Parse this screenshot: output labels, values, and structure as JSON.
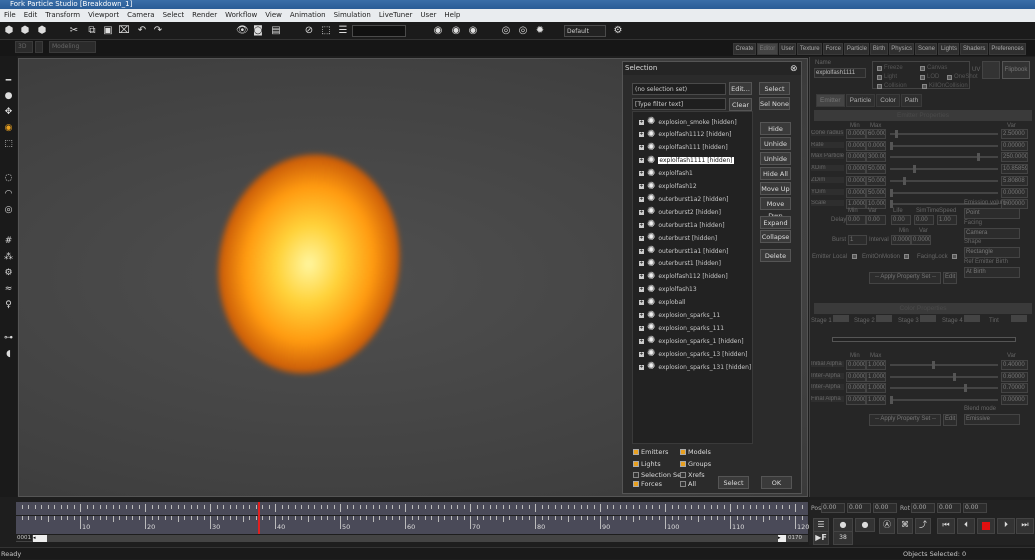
{
  "window": {
    "title": "Fork Particle Studio [Breakdown_1]"
  },
  "menu": [
    "File",
    "Edit",
    "Transform",
    "Viewport",
    "Camera",
    "Select",
    "Render",
    "Workflow",
    "View",
    "Animation",
    "Simulation",
    "LiveTuner",
    "User",
    "Help"
  ],
  "toolbar": {
    "preset_value": "Default",
    "view_mode": "3D",
    "mode_value": "Modeling"
  },
  "right_tabs": [
    "Create",
    "Editor",
    "User",
    "Texture",
    "Force",
    "Particle",
    "Birth",
    "Physics",
    "Scene",
    "Lights",
    "Shaders",
    "Preferences"
  ],
  "active_right_tab": "Editor",
  "selection_dialog": {
    "title": "Selection",
    "selection_set": "(no selection set)",
    "edit_label": "Edit...",
    "filter_placeholder": "[Type filter text]",
    "clear_label": "Clear",
    "select_all": "Select All",
    "sel_none": "Sel None",
    "side_buttons": [
      "Hide",
      "Unhide",
      "Unhide All",
      "Hide All",
      "Move Up",
      "Move Dwn",
      "Expand All",
      "Collapse",
      "Delete"
    ],
    "items": [
      {
        "label": "explosion_smoke  [hidden]"
      },
      {
        "label": "explolfash1112  [hidden]"
      },
      {
        "label": "explolfash111  [hidden]"
      },
      {
        "label": "explolfash1111  [hidden]",
        "selected": true
      },
      {
        "label": "explolfash1"
      },
      {
        "label": "explolfash12"
      },
      {
        "label": "outerburst1a2  [hidden]"
      },
      {
        "label": "outerburst2  [hidden]"
      },
      {
        "label": "outerburst1a  [hidden]"
      },
      {
        "label": "outerburst  [hidden]"
      },
      {
        "label": "outerburst1a1  [hidden]"
      },
      {
        "label": "outerburst1  [hidden]"
      },
      {
        "label": "explolfash112  [hidden]"
      },
      {
        "label": "explolfash13"
      },
      {
        "label": "exploball"
      },
      {
        "label": "explosion_sparks_11"
      },
      {
        "label": "explosion_sparks_111"
      },
      {
        "label": "explosion_sparks_1  [hidden]"
      },
      {
        "label": "explosion_sparks_13  [hidden]"
      },
      {
        "label": "explosion_sparks_131  [hidden]"
      }
    ],
    "filters": [
      {
        "label": "Emitters",
        "checked": true
      },
      {
        "label": "Models",
        "checked": true
      },
      {
        "label": "Lights",
        "checked": true
      },
      {
        "label": "Groups",
        "checked": true
      },
      {
        "label": "Selection Set",
        "checked": false
      },
      {
        "label": "Xrefs",
        "checked": false
      },
      {
        "label": "Forces",
        "checked": true
      },
      {
        "label": "All",
        "checked": false
      }
    ],
    "select_label": "Select",
    "ok_label": "OK"
  },
  "editor": {
    "name_label": "Name",
    "name_value": "explolfash1111",
    "flags": [
      {
        "label": "Freeze"
      },
      {
        "label": "Canvas"
      },
      {
        "label": "Light"
      },
      {
        "label": "LOD"
      },
      {
        "label": "OneShot"
      },
      {
        "label": "Collision"
      },
      {
        "label": "KillOnCollision"
      }
    ],
    "uv_label": "UV",
    "flipbook_label": "Flipbook",
    "subtabs": [
      "Emitter",
      "Particle",
      "Color",
      "Path"
    ],
    "emitter_header": "Emitter Properties",
    "col_min": "Min",
    "col_max": "Max",
    "col_var": "Var",
    "props": [
      {
        "label": "Cone radius",
        "min": "0.0000",
        "max": "60.000",
        "var": "2.50000",
        "slider": 0.05
      },
      {
        "label": "Rate",
        "min": "0.0000",
        "max": "0.0000",
        "var": "0.00000",
        "slider": 0
      },
      {
        "label": "Max Particle",
        "min": "0.0000",
        "max": "300.00",
        "var": "250.0000",
        "slider": 0.83
      },
      {
        "label": "XDim",
        "min": "0.0000",
        "max": "50.000",
        "var": "10.85859",
        "slider": 0.22
      },
      {
        "label": "ZDim",
        "min": "0.0000",
        "max": "50.000",
        "var": "5.80808",
        "slider": 0.12
      },
      {
        "label": "YDim",
        "min": "0.0000",
        "max": "50.000",
        "var": "0.00000",
        "slider": 0
      },
      {
        "label": "Scale",
        "min": "1.0000",
        "max": "10.000",
        "var": "1.00000",
        "slider": 0
      }
    ],
    "delay": {
      "label": "Delay",
      "heads": [
        "Min",
        "Var",
        "Life",
        "SimTime",
        "Speed"
      ],
      "values": [
        "0.00",
        "0.00",
        "0.00",
        "0.00",
        "1.00"
      ]
    },
    "burst": {
      "label": "Burst",
      "value": "1",
      "interval_label": "Interval",
      "heads": [
        "Min",
        "Var"
      ],
      "values": [
        "0.0000",
        "0.0000"
      ]
    },
    "checks": [
      "Emitter Local",
      "EmitOnMotion",
      "FacingLock"
    ],
    "emission_volume": {
      "label": "Emission volume",
      "value": "Point"
    },
    "facing": {
      "label": "Facing",
      "value": "Camera"
    },
    "shape": {
      "label": "Shape",
      "value": "Rectangle"
    },
    "ref_birth": {
      "label": "Ref Emitter Birth",
      "value": "At Birth"
    },
    "apply_label": "-- Apply Property Set --",
    "edit_label": "Edit",
    "color_header": "Color Properties",
    "stages": [
      "Stage 1",
      "Stage 2",
      "Stage 3",
      "Stage 4",
      "Tint"
    ],
    "alphas": [
      {
        "label": "Initial Alpha",
        "min": "0.0000",
        "max": "1.0000",
        "var": "0.40000",
        "slider": 0.4
      },
      {
        "label": "Inter-Alpha",
        "min": "0.0000",
        "max": "1.0000",
        "var": "0.60000",
        "slider": 0.6
      },
      {
        "label": "Inter-Alpha",
        "min": "0.0000",
        "max": "1.0000",
        "var": "0.70000",
        "slider": 0.7
      },
      {
        "label": "Final Alpha",
        "min": "0.0000",
        "max": "1.0000",
        "var": "0.00000",
        "slider": 0
      }
    ],
    "blend": {
      "label": "Blend mode",
      "value": "Emissive"
    }
  },
  "timeline": {
    "labels": [
      "10",
      "20",
      "30",
      "40",
      "50",
      "60",
      "70",
      "80",
      "90",
      "100",
      "110",
      "120"
    ],
    "current_frame": 38,
    "start": "0001",
    "end": "0170"
  },
  "transform": {
    "pos_label": "Pos",
    "pos": [
      "0.00",
      "0.00",
      "0.00"
    ],
    "rot_label": "Rot",
    "rot": [
      "0.00",
      "0.00",
      "0.00"
    ]
  },
  "playback": {
    "frame": "38"
  },
  "status": {
    "left": "Ready",
    "objects": "Objects Selected: 0"
  },
  "colors": {
    "accent": "#e8a020",
    "playhead": "#e02020",
    "record": "#e01010"
  }
}
